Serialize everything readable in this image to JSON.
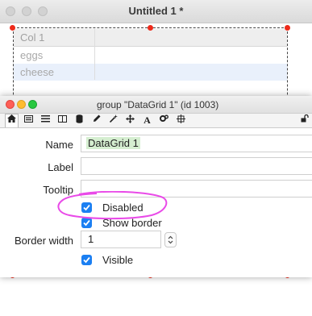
{
  "background_window": {
    "title": "Untitled 1 *",
    "grid": {
      "columns": [
        "Col 1",
        ""
      ],
      "rows": [
        [
          "eggs",
          ""
        ],
        [
          "cheese",
          ""
        ]
      ]
    }
  },
  "inspector": {
    "title": "group \"DataGrid 1\" (id 1003)",
    "toolbar_icons": [
      "house-icon",
      "card-icon",
      "list-icon",
      "columns-icon",
      "database-icon",
      "pencil-icon",
      "magic-wand-icon",
      "move-icon",
      "text-icon",
      "gears-icon",
      "position-icon",
      "lock-icon"
    ],
    "fields": {
      "name_label": "Name",
      "name_value": "DataGrid 1",
      "label_label": "Label",
      "label_value": "",
      "tooltip_label": "Tooltip",
      "tooltip_value": "",
      "border_width_label": "Border width",
      "border_width_value": "1"
    },
    "checkboxes": {
      "disabled": {
        "label": "Disabled",
        "checked": true
      },
      "show_border": {
        "label": "Show border",
        "checked": true
      },
      "visible": {
        "label": "Visible",
        "checked": true
      }
    }
  },
  "colors": {
    "selection_handle": "#ee2a1a",
    "checkbox_blue": "#1b7ff2",
    "name_highlight": "#d5eed0",
    "annotation_circle": "#e94ae8"
  }
}
